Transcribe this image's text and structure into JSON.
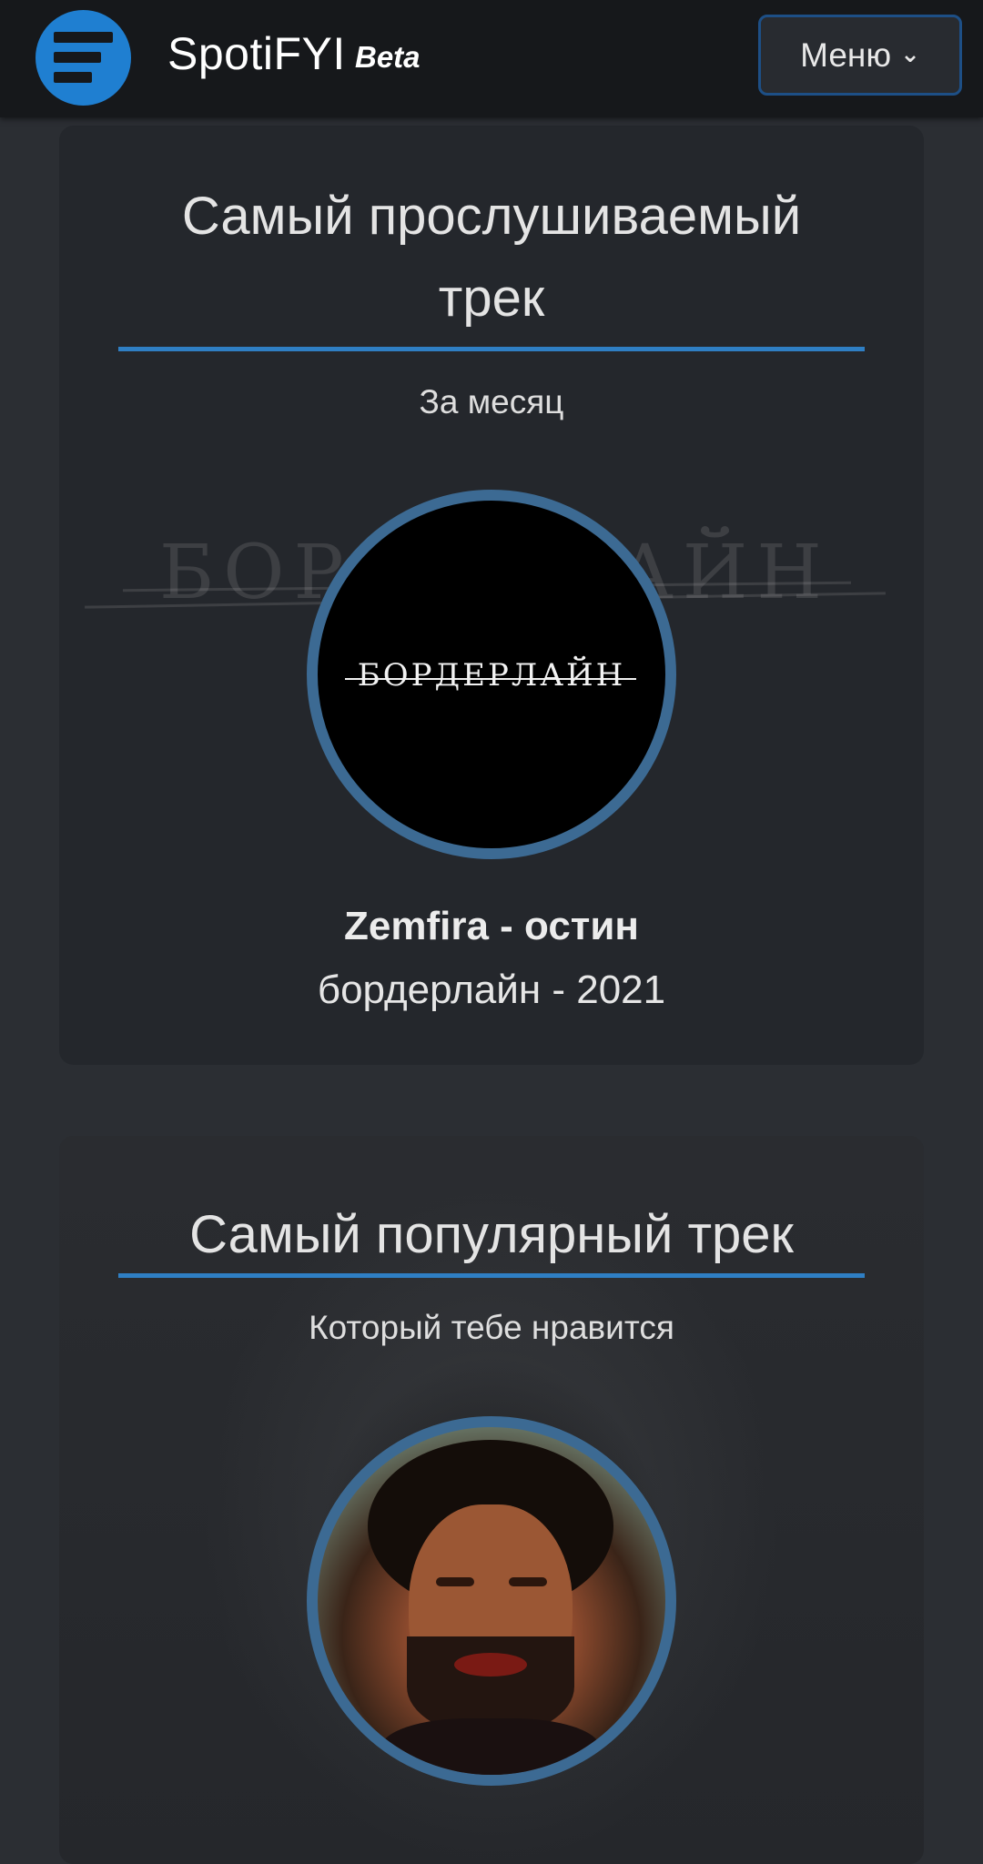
{
  "header": {
    "app_name": "SpotiFYI",
    "badge": "Beta",
    "menu_label": "Меню",
    "logo_icon": "bars-logo-icon"
  },
  "cards": [
    {
      "title": "Самый прослушиваемый трек",
      "subtitle": "За месяц",
      "artist_track": "Zemfira - остин",
      "album_year": "бордерлайн - 2021",
      "cover_text": "БОРДЕРЛАЙН"
    },
    {
      "title": "Самый популярный трек",
      "subtitle": "Который тебе нравится"
    }
  ],
  "colors": {
    "accent": "#2f7fc4",
    "cover_ring": "#3c6a93",
    "header_bg": "#16181b",
    "page_bg": "#2b2e33",
    "card_bg": "#24272c"
  }
}
